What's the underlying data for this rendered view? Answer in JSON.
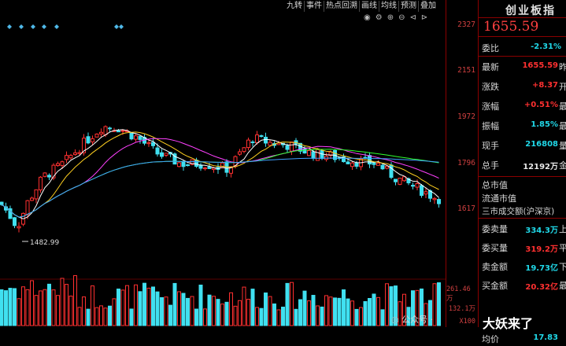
{
  "toolbar": {
    "items": [
      "九转",
      "事件",
      "热点回溯",
      "画线",
      "均线",
      "预测",
      "叠加"
    ]
  },
  "scale": {
    "labels": [
      "2327",
      "2151",
      "1972",
      "1796",
      "1617",
      "261.46万",
      "132.1万",
      "X100"
    ]
  },
  "chart": {
    "low_annotation": "1482.99"
  },
  "panel": {
    "title": "创业板指",
    "price": "1655.59",
    "ratio_label": "委比",
    "ratio_value": "-2.31%",
    "rows": [
      {
        "label": "最新",
        "value": "1655.59",
        "color": "#ff3030",
        "tail": "昨"
      },
      {
        "label": "涨跌",
        "value": "+8.37",
        "color": "#ff3030",
        "tail": "开"
      },
      {
        "label": "涨幅",
        "value": "+0.51%",
        "color": "#ff3030",
        "tail": "最"
      },
      {
        "label": "振幅",
        "value": "1.85%",
        "color": "#20d8e8",
        "tail": "最"
      },
      {
        "label": "现手",
        "value": "216808",
        "color": "#20d8e8",
        "tail": "量"
      },
      {
        "label": "总手",
        "value": "12192万",
        "color": "#e8e8e8",
        "tail": "金"
      }
    ],
    "stats": [
      "总市值",
      "流通市值",
      "三市成交额(沪深京)"
    ],
    "orders": [
      {
        "label": "委卖量",
        "value": "334.3万",
        "color": "#20d8e8",
        "tail": "上"
      },
      {
        "label": "委买量",
        "value": "319.2万",
        "color": "#ff3030",
        "tail": "平"
      },
      {
        "label": "卖金额",
        "value": "19.73亿",
        "color": "#20d8e8",
        "tail": "下"
      },
      {
        "label": "买金额",
        "value": "20.32亿",
        "color": "#ff3030",
        "tail": "最"
      }
    ],
    "partial": [
      {
        "label": "均价",
        "value": "17.83",
        "color": "#20d8e8"
      }
    ]
  },
  "watermark": {
    "small": "公众号 ·",
    "big": "大妖来了"
  }
}
